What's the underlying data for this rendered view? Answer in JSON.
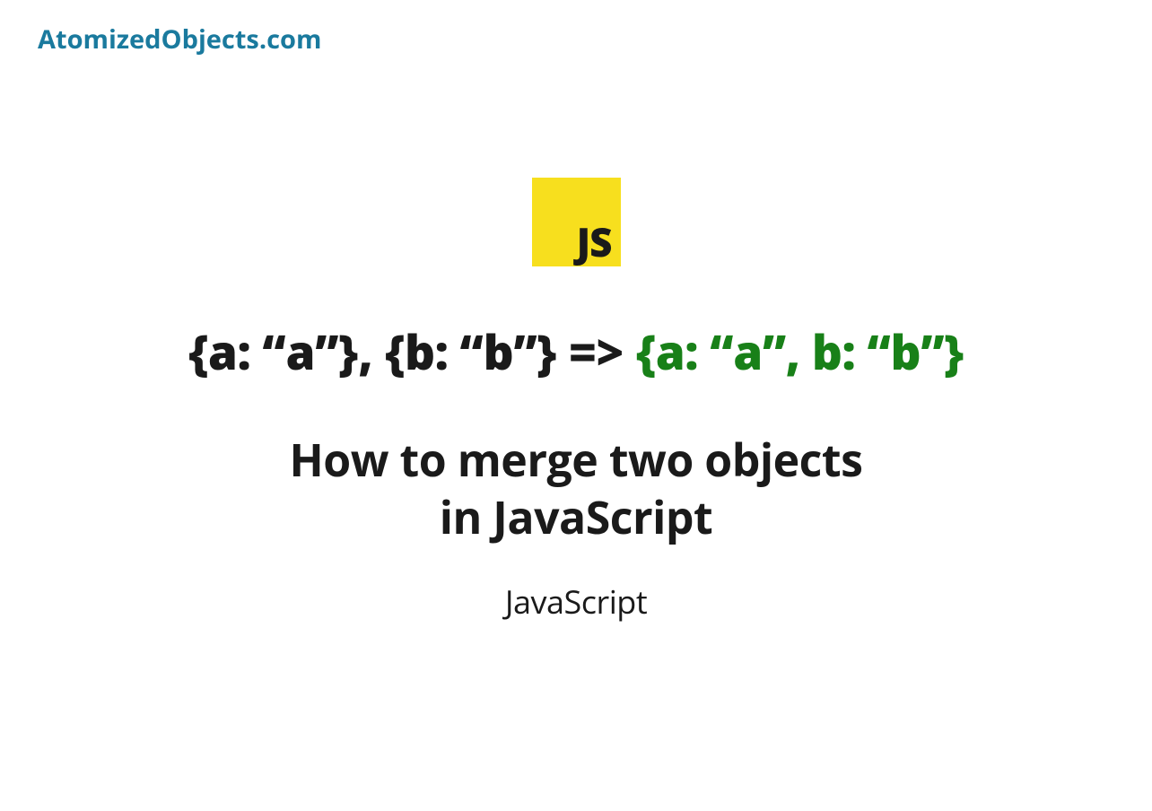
{
  "site_name": "AtomizedObjects.com",
  "logo": {
    "text": "JS"
  },
  "code_example": {
    "left_part": "{a: “a”}, {b: “b”} => ",
    "right_part": "{a: “a”, b: “b”}"
  },
  "title": {
    "line1": "How to merge two objects",
    "line2": "in JavaScript"
  },
  "category": "JavaScript"
}
